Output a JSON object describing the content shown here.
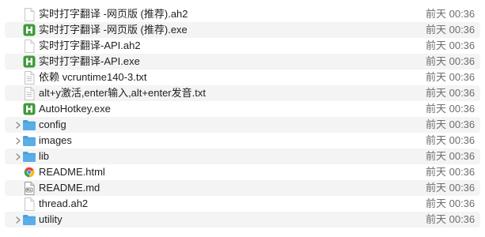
{
  "files": [
    {
      "name": "实时打字翻译 -网页版 (推荐).ah2",
      "date": "前天 00:36",
      "icon": "document-icon",
      "expandable": false
    },
    {
      "name": "实时打字翻译 -网页版 (推荐).exe",
      "date": "前天 00:36",
      "icon": "autohotkey-icon",
      "expandable": false
    },
    {
      "name": "实时打字翻译-API.ah2",
      "date": "前天 00:36",
      "icon": "document-icon",
      "expandable": false
    },
    {
      "name": "实时打字翻译-API.exe",
      "date": "前天 00:36",
      "icon": "autohotkey-icon",
      "expandable": false
    },
    {
      "name": "依赖 vcruntime140-3.txt",
      "date": "前天 00:36",
      "icon": "text-file-icon",
      "expandable": false
    },
    {
      "name": "alt+y激活,enter输入,alt+enter发音.txt",
      "date": "前天 00:36",
      "icon": "text-file-icon",
      "expandable": false
    },
    {
      "name": "AutoHotkey.exe",
      "date": "前天 00:36",
      "icon": "autohotkey-icon",
      "expandable": false
    },
    {
      "name": "config",
      "date": "前天 00:36",
      "icon": "folder-icon",
      "expandable": true
    },
    {
      "name": "images",
      "date": "前天 00:36",
      "icon": "folder-icon",
      "expandable": true
    },
    {
      "name": "lib",
      "date": "前天 00:36",
      "icon": "folder-icon",
      "expandable": true
    },
    {
      "name": "README.html",
      "date": "前天 00:36",
      "icon": "html-file-icon",
      "expandable": false
    },
    {
      "name": "README.md",
      "date": "前天 00:36",
      "icon": "markdown-file-icon",
      "expandable": false
    },
    {
      "name": "thread.ah2",
      "date": "前天 00:36",
      "icon": "document-icon",
      "expandable": false
    },
    {
      "name": "utility",
      "date": "前天 00:36",
      "icon": "folder-icon",
      "expandable": true
    }
  ],
  "colors": {
    "row_alt": "#f4f4f4",
    "folder": "#5aaee8",
    "autohotkey": "#3f9a3a",
    "date_text": "#6e6e6e"
  }
}
